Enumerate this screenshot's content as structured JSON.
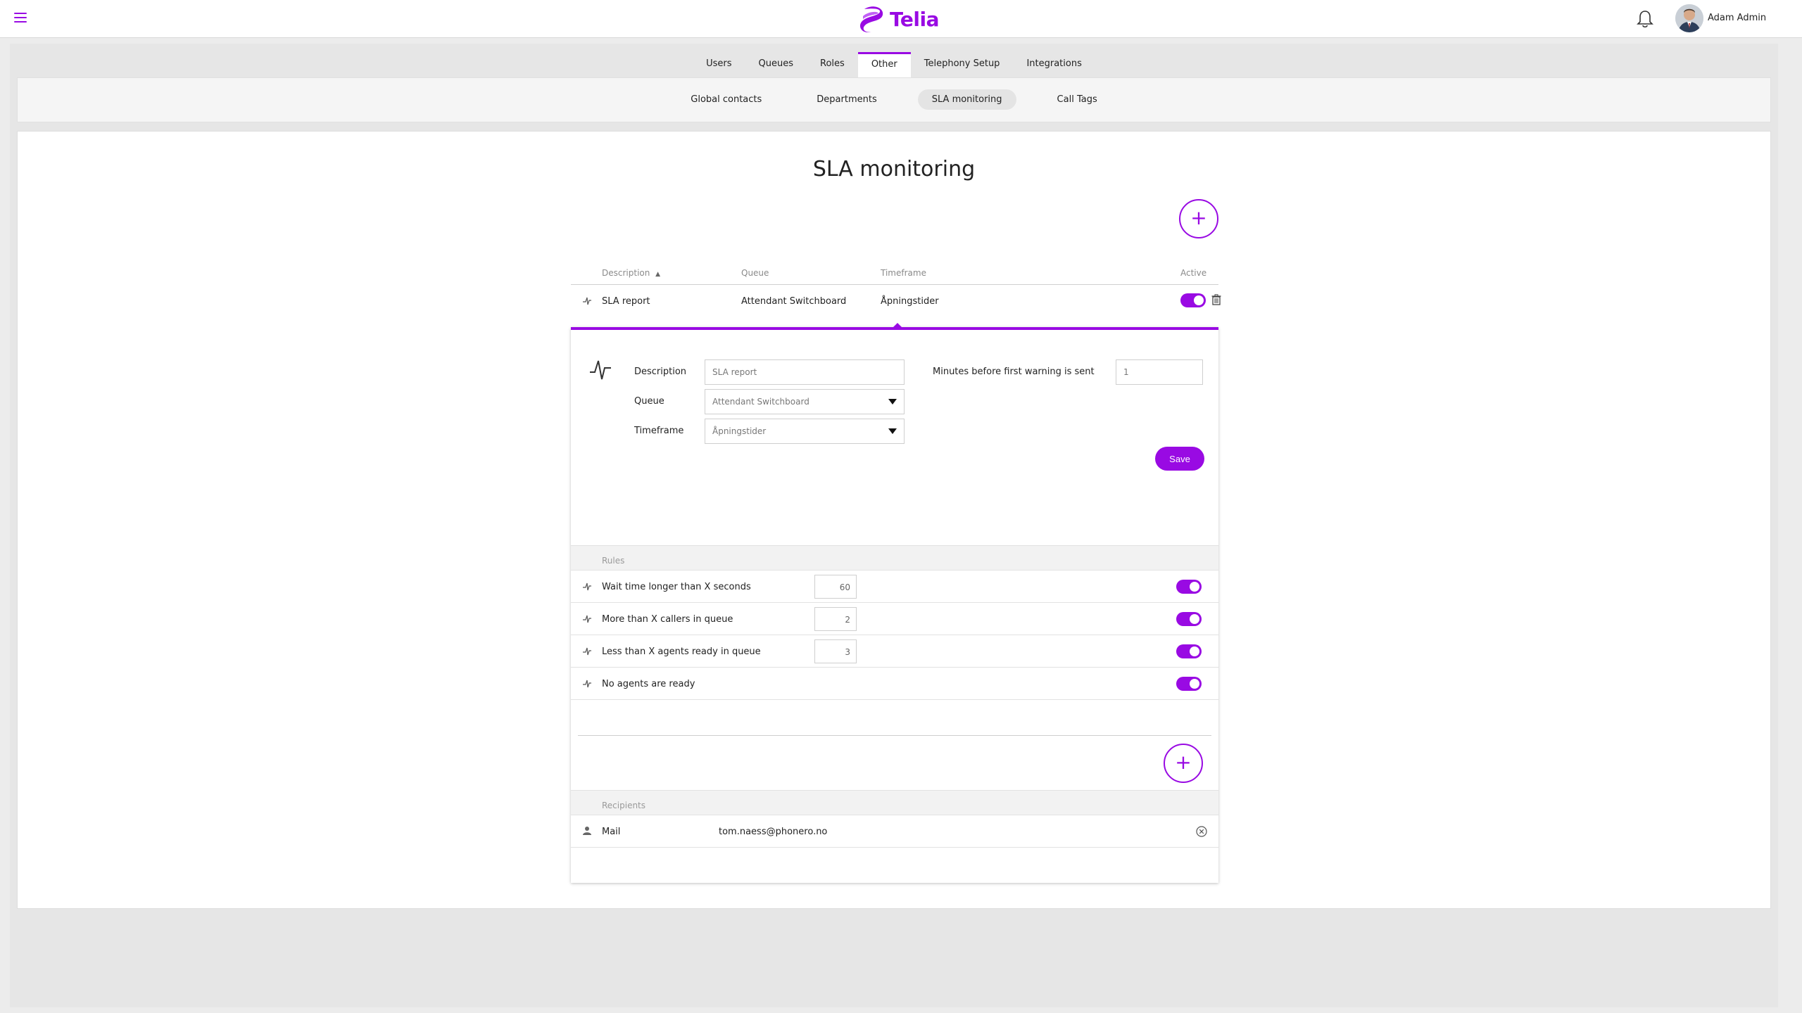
{
  "header": {
    "brand": "Telia",
    "user_name": "Adam Admin",
    "accent": "#990ae3"
  },
  "main_tabs": [
    {
      "label": "Users",
      "active": false
    },
    {
      "label": "Queues",
      "active": false
    },
    {
      "label": "Roles",
      "active": false
    },
    {
      "label": "Other",
      "active": true
    },
    {
      "label": "Telephony Setup",
      "active": false
    },
    {
      "label": "Integrations",
      "active": false
    }
  ],
  "sub_tabs": [
    {
      "label": "Global contacts",
      "active": false
    },
    {
      "label": "Departments",
      "active": false
    },
    {
      "label": "SLA monitoring",
      "active": true
    },
    {
      "label": "Call Tags",
      "active": false
    }
  ],
  "page": {
    "title": "SLA monitoring",
    "add_symbol": "+"
  },
  "table": {
    "columns": {
      "description": "Description",
      "queue": "Queue",
      "timeframe": "Timeframe",
      "active": "Active"
    },
    "sort_indicator": "▲",
    "rows": [
      {
        "description": "SLA report",
        "queue": "Attendant Switchboard",
        "timeframe": "Åpningstider",
        "active": true
      }
    ]
  },
  "editor": {
    "description_label": "Description",
    "description_value": "SLA report",
    "queue_label": "Queue",
    "queue_value": "Attendant Switchboard",
    "timeframe_label": "Timeframe",
    "timeframe_value": "Åpningstider",
    "minutes_label": "Minutes before first warning is sent",
    "minutes_value": "1",
    "save_label": "Save",
    "rules_title": "Rules",
    "rules": [
      {
        "name": "Wait time longer than X seconds",
        "value": "60",
        "active": true
      },
      {
        "name": "More than X callers in queue",
        "value": "2",
        "active": true
      },
      {
        "name": "Less than X agents ready in queue",
        "value": "3",
        "active": true
      },
      {
        "name": "No agents are ready",
        "value": null,
        "active": true
      }
    ],
    "recipients_title": "Recipients",
    "recipients": [
      {
        "type": "Mail",
        "address": "tom.naess@phonero.no"
      }
    ]
  }
}
